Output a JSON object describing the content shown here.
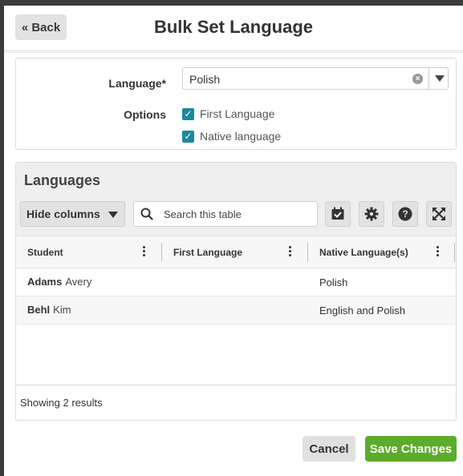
{
  "header": {
    "back_label": "« Back",
    "title": "Bulk Set Language"
  },
  "form": {
    "language_label": "Language*",
    "language_value": "Polish",
    "options_label": "Options",
    "options": [
      {
        "label": "First Language",
        "checked": true
      },
      {
        "label": "Native language",
        "checked": true
      }
    ]
  },
  "table": {
    "title": "Languages",
    "hide_columns_label": "Hide columns",
    "search_placeholder": "Search this table",
    "tool_icons": [
      "calendar-check-icon",
      "gear-icon",
      "help-icon",
      "expand-icon"
    ],
    "columns": [
      "Student",
      "First Language",
      "Native Language(s)"
    ],
    "rows": [
      {
        "last": "Adams",
        "first": "Avery",
        "first_language": "",
        "native": "Polish"
      },
      {
        "last": "Behl",
        "first": "Kim",
        "first_language": "",
        "native": "English and Polish"
      }
    ],
    "footer": "Showing 2 results"
  },
  "actions": {
    "cancel_label": "Cancel",
    "save_label": "Save Changes"
  },
  "colors": {
    "checkbox": "#1a8a9b",
    "save_button": "#5cab2b",
    "neutral_button": "#e2e2e2"
  }
}
